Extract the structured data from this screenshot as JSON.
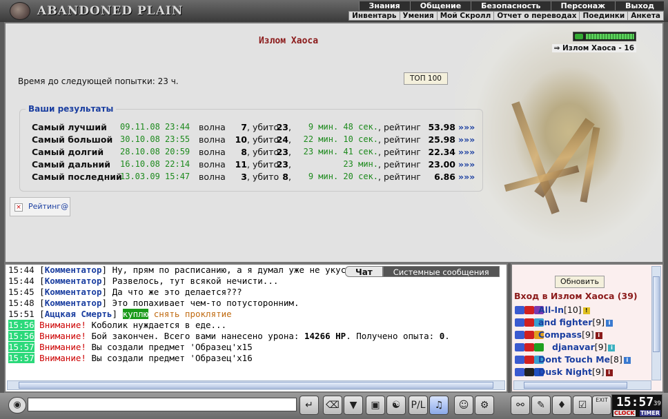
{
  "header": {
    "logo_text": "ABANDONED PLAIN",
    "menu_main": [
      "Знания",
      "Общение",
      "Безопасность",
      "Персонаж",
      "Выход"
    ],
    "menu_sub": [
      "Инвентарь",
      "Умения",
      "Мой Скролл",
      "Отчет о переводах",
      "Поединки",
      "Анкета"
    ]
  },
  "main": {
    "title": "Излом Хаоса",
    "wait_text": "Время до следующей попытки: 23 ч.",
    "top100_label": "ТОП 100",
    "results_legend": "Ваши результаты",
    "results": [
      {
        "label": "Самый лучший",
        "date": "09.11.08 23:44",
        "wave_label": "волна",
        "wave": "7",
        "kills_label": ", убито",
        "kills": "23",
        "comma": ",",
        "time": "9 мин. 48 сек.",
        "rating_label": ", рейтинг",
        "rating": "53.98",
        "arrow": "»»»"
      },
      {
        "label": "Самый большой",
        "date": "30.10.08 23:55",
        "wave_label": "волна",
        "wave": "10",
        "kills_label": ", убито",
        "kills": "24",
        "comma": ",",
        "time": "22 мин. 10 сек.",
        "rating_label": ", рейтинг",
        "rating": "25.98",
        "arrow": "»»»"
      },
      {
        "label": "Самый долгий",
        "date": "28.10.08 20:59",
        "wave_label": "волна",
        "wave": "8",
        "kills_label": ", убито",
        "kills": "23",
        "comma": ",",
        "time": "23 мин. 41 сек.",
        "rating_label": ", рейтинг",
        "rating": "22.34",
        "arrow": "»»»"
      },
      {
        "label": "Самый дальний",
        "date": "16.10.08 22:14",
        "wave_label": "волна",
        "wave": "11",
        "kills_label": ", убито",
        "kills": "23",
        "comma": ",",
        "time": "23 мин.",
        "rating_label": ", рейтинг",
        "rating": "23.00",
        "arrow": "»»»"
      },
      {
        "label": "Самый последний",
        "date": "13.03.09 15:47",
        "wave_label": "волна",
        "wave": "3",
        "kills_label": ", убито",
        "kills": "8",
        "comma": ",",
        "time": "9 мин. 20 сек.",
        "rating_label": ", рейтинг",
        "rating": "6.86",
        "arrow": "»»»"
      }
    ],
    "rating_link": "Рейтинг@",
    "rating_x": "×",
    "status_label": "Излом Хаоса - 16"
  },
  "chat": {
    "tabs": [
      "Чат",
      "Системные сообщения"
    ],
    "lines": [
      {
        "time": "15:44",
        "hl": false,
        "name": "Комментатор",
        "text": "Ну, прям по расписанию, а я думал уже не укусят"
      },
      {
        "time": "15:44",
        "hl": false,
        "name": "Комментатор",
        "text": "Развелось, тут всякой нечисти..."
      },
      {
        "time": "15:45",
        "hl": false,
        "name": "Комментатор",
        "text": "Да что же это делается???"
      },
      {
        "time": "15:48",
        "hl": false,
        "name": "Комментатор",
        "text": "Это попахивает чем-то потусторонним."
      },
      {
        "time": "15:51",
        "hl": false,
        "name": "Аццкая Смерть",
        "buy": "куплю",
        "curse": "снять проклятие"
      },
      {
        "time": "15:56",
        "hl": true,
        "warn": "Внимание!",
        "text": "Коболик нуждается в еде..."
      },
      {
        "time": "15:56",
        "hl": true,
        "warn": "Внимание!",
        "text": "Бой закончен. Всего вами нанесено урона:",
        "bold1": "14266 HP",
        "text2": ". Получено опыта:",
        "bold2": "0",
        "text3": "."
      },
      {
        "time": "15:57",
        "hl": true,
        "warn": "Внимание!",
        "text": "Вы создали предмет 'Образец'x15"
      },
      {
        "time": "15:57",
        "hl": true,
        "warn": "Внимание!",
        "text": "Вы создали предмет 'Образец'x16"
      }
    ]
  },
  "online": {
    "refresh_label": "Обновить",
    "title": "Вход в Излом Хаоса (39)",
    "users": [
      {
        "name": "All-In",
        "level": "[10]",
        "info": "!"
      },
      {
        "name": "and fighter",
        "level": "[9]",
        "info": "i"
      },
      {
        "name": "Compass",
        "level": "[9]",
        "info": "i"
      },
      {
        "name": "djanavar",
        "level": "[9]",
        "info": "i"
      },
      {
        "name": "Dont Touch Me",
        "level": "[8]",
        "info": "i"
      },
      {
        "name": "Dusk Night",
        "level": "[9]",
        "info": "i"
      }
    ]
  },
  "toolbar": {
    "clock_time": "15:57",
    "clock_seconds": "39",
    "clock_label": "CLOCK",
    "timer_label": "TIMER",
    "exit_label": "EXIT"
  },
  "colors": {
    "accent_red": "#8b1a1a",
    "link_blue": "#1a3ea0",
    "date_green": "#1d8a1d",
    "warn_red": "#cc0000",
    "time_highlight": "#2bd97a"
  }
}
